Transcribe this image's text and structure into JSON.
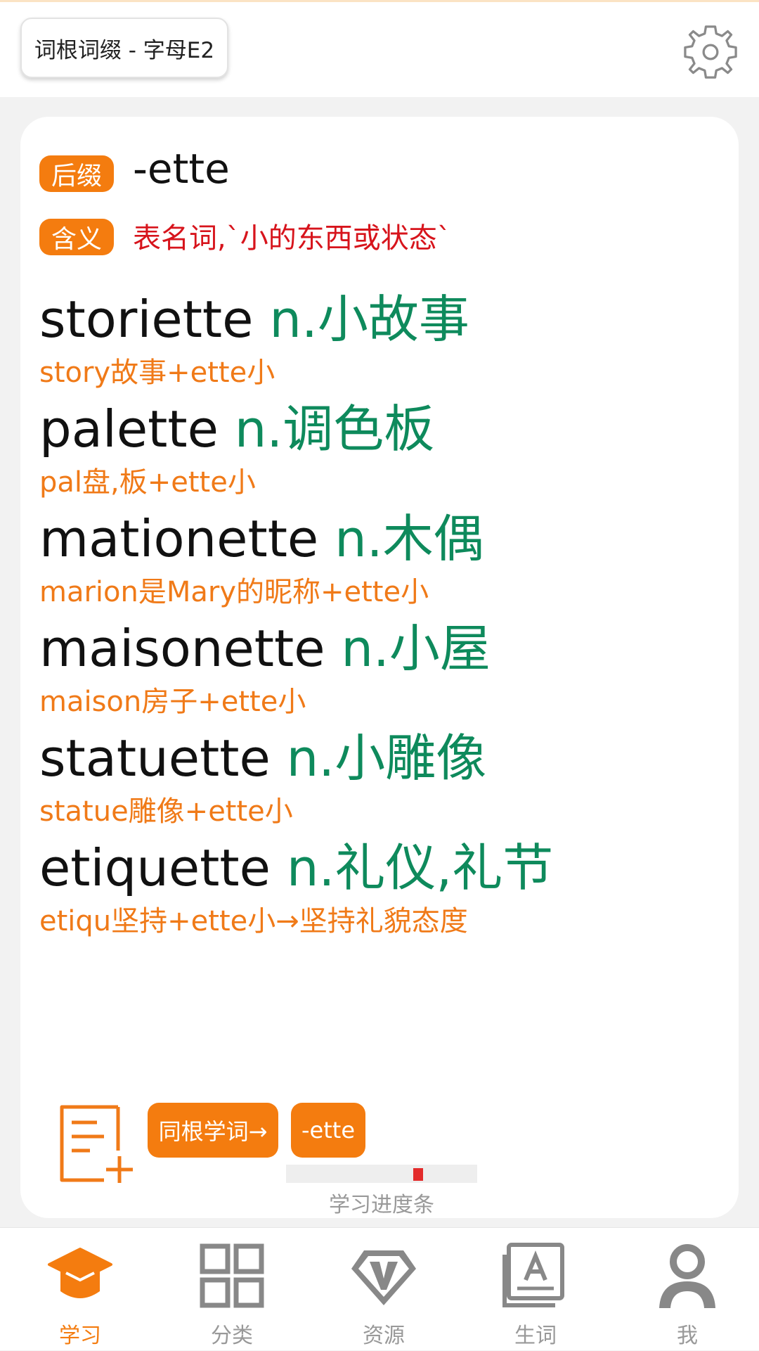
{
  "header": {
    "title": "词根词缀 - 字母E2",
    "settings_icon": "gear-icon"
  },
  "affix": {
    "suffix_tag": "后缀",
    "suffix": "-ette",
    "meaning_tag": "含义",
    "meaning": "表名词,`小的东西或状态`"
  },
  "entries": [
    {
      "word": "storiette",
      "def": "n.小故事",
      "ety": "story故事+ette小"
    },
    {
      "word": "palette",
      "def": "n.调色板",
      "ety": "pal盘,板+ette小"
    },
    {
      "word": "mationette",
      "def": "n.木偶",
      "ety": "marion是Mary的昵称+ette小"
    },
    {
      "word": "maisonette",
      "def": "n.小屋",
      "ety": "maison房子+ette小"
    },
    {
      "word": "statuette",
      "def": "n.小雕像",
      "ety": "statue雕像+ette小"
    },
    {
      "word": "etiquette",
      "def": "n.礼仪,礼节",
      "ety": "etiqu坚持+ette小→坚持礼貌态度"
    }
  ],
  "actions": {
    "related_button": "同根学词→",
    "ette_button": "-ette",
    "progress_label": "学习进度条",
    "progress_fraction": 0.7,
    "accent_color": "#f47c0f",
    "progress_color": "#e32b2b"
  },
  "tabs": [
    {
      "label": "学习",
      "icon": "graduation-cap-icon",
      "active": true
    },
    {
      "label": "分类",
      "icon": "grid-icon",
      "active": false
    },
    {
      "label": "资源",
      "icon": "v-diamond-icon",
      "active": false
    },
    {
      "label": "生词",
      "icon": "book-icon",
      "active": false
    },
    {
      "label": "我",
      "icon": "user-icon",
      "active": false
    }
  ]
}
